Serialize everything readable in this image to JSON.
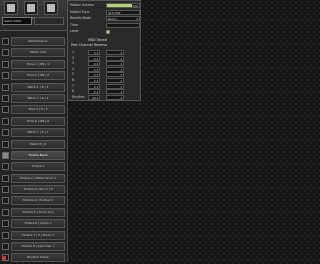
{
  "toolbar": {
    "buttons": [
      {
        "label": "Edit",
        "icon": "edit-icon"
      },
      {
        "label": "Midi",
        "icon": "midi-icon"
      },
      {
        "label": "Setup",
        "icon": "setup-icon"
      }
    ],
    "display": "Gakki 2000"
  },
  "patches": [
    {
      "label": "Performance",
      "checked": false
    },
    {
      "label": "Patch: Inst",
      "checked": false
    },
    {
      "label": "Tone 1 | ON | 1",
      "checked": false
    },
    {
      "label": "Tone 2 | ON | 2",
      "checked": false
    },
    {
      "label": "Patch 1 | 6 | 3",
      "checked": false
    },
    {
      "label": "Patch 2 | 6 | 4",
      "checked": false
    },
    {
      "label": "Tone 5 | 6 | 5",
      "checked": false
    },
    {
      "label": "Tone 6 | ON | 6",
      "checked": false
    },
    {
      "label": "Patch 7 | 6 | 7",
      "checked": false
    },
    {
      "label": "Patch 8 | 6",
      "checked": false
    },
    {
      "label": "Timbre Bank",
      "checked": true
    },
    {
      "label": "Timbre 1",
      "checked": false
    },
    {
      "label": "Timbre 2 | Other Drum 1",
      "checked": false
    },
    {
      "label": "Timbre 3 | Pno 2 | 6",
      "checked": false
    },
    {
      "label": "Timbre 4 | Hookup 2",
      "checked": false
    },
    {
      "label": "Timbre 5 | Drum Grp",
      "checked": false
    },
    {
      "label": "Timbre 6 | Super 1",
      "checked": false
    },
    {
      "label": "Timbre 7 | 3 | Drum 2",
      "checked": false
    },
    {
      "label": "Timbre 8 | Launcher 1",
      "checked": false
    },
    {
      "label": "Rhythm Setup",
      "checked": false
    }
  ],
  "props": {
    "rows": [
      {
        "label": "Master Volume",
        "kind": "slider",
        "value": "100",
        "fill": 0.78
      },
      {
        "label": "Master Tune",
        "kind": "text",
        "value": "415.3Hz"
      },
      {
        "label": "Reverb Mode",
        "kind": "select",
        "value": "Room"
      },
      {
        "label": "Time",
        "kind": "text",
        "value": ""
      },
      {
        "label": "Level",
        "kind": "led",
        "value": ""
      }
    ],
    "columns": [
      "MIDI",
      "Tone#"
    ],
    "subheader": "Part Channel  Reserve",
    "midi_rows": [
      {
        "index": "1",
        "ch": "2",
        "reserve": "1"
      },
      {
        "index": "2",
        "ch": "2",
        "reserve": "1"
      },
      {
        "index": "3",
        "ch": "2",
        "reserve": "1"
      },
      {
        "index": "4",
        "ch": "2",
        "reserve": "1"
      },
      {
        "index": "5",
        "ch": "2",
        "reserve": "1"
      },
      {
        "index": "6",
        "ch": "2",
        "reserve": "1"
      },
      {
        "index": "7",
        "ch": "2",
        "reserve": "1"
      },
      {
        "index": "8",
        "ch": "2",
        "reserve": "1"
      },
      {
        "index": "Rhythm",
        "ch": "10",
        "reserve": "1"
      }
    ]
  }
}
